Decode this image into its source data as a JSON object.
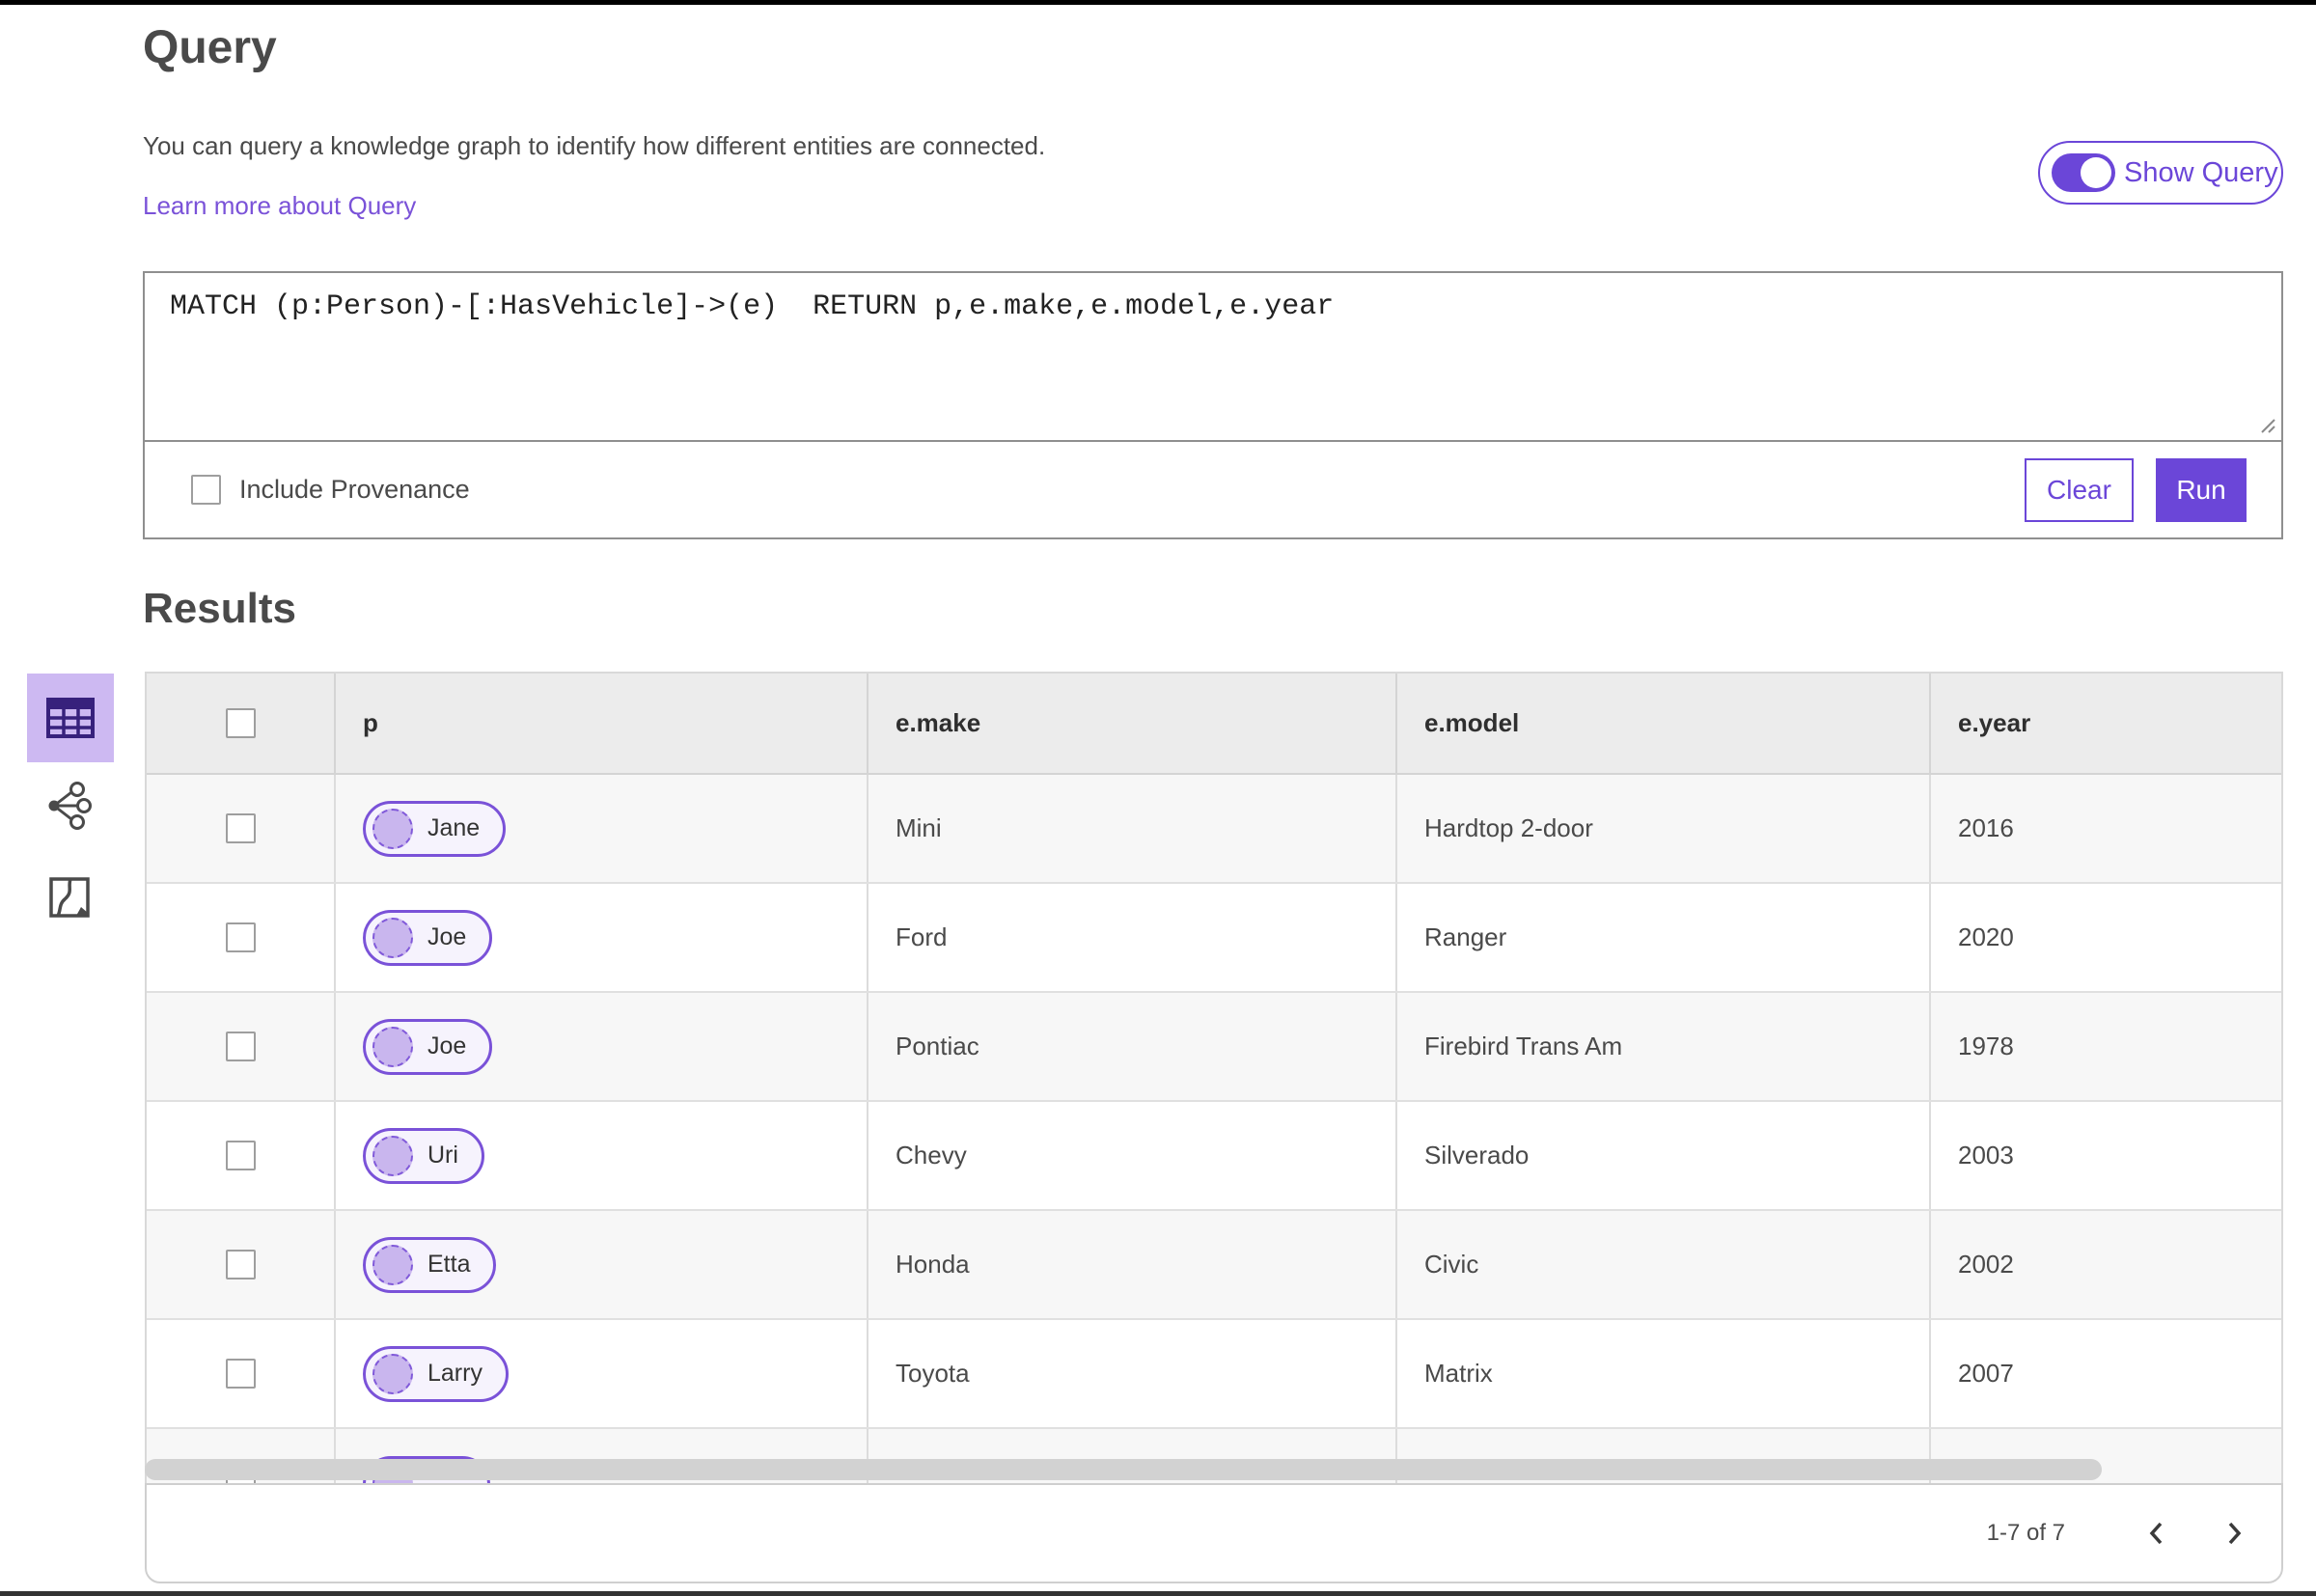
{
  "colors": {
    "accent_purple": "#6b46d8",
    "pill_border_purple": "#7a52d8",
    "selected_view_bg": "#cdb9f2",
    "header_row_bg": "#ececec",
    "alt_row_bg": "#f7f7f7"
  },
  "header": {
    "title": "Query",
    "description": "You can query a knowledge graph to identify how different entities are connected.",
    "learn_more_link": "Learn more about Query",
    "show_query_toggle": {
      "label": "Show Query",
      "state": "on"
    }
  },
  "query_editor": {
    "query_text": "MATCH (p:Person)-[:HasVehicle]->(e)  RETURN p,e.make,e.model,e.year",
    "include_provenance": {
      "label": "Include Provenance",
      "checked": false
    },
    "clear_button": "Clear",
    "run_button": "Run"
  },
  "results": {
    "title": "Results",
    "view_switcher": [
      {
        "name": "table-view",
        "selected": true
      },
      {
        "name": "link-chart-view",
        "selected": false
      },
      {
        "name": "map-view",
        "selected": false
      }
    ],
    "table": {
      "columns": [
        "p",
        "e.make",
        "e.model",
        "e.year"
      ],
      "rows": [
        {
          "p": "Jane",
          "make": "Mini",
          "model": "Hardtop 2-door",
          "year": "2016"
        },
        {
          "p": "Joe",
          "make": "Ford",
          "model": "Ranger",
          "year": "2020"
        },
        {
          "p": "Joe",
          "make": "Pontiac",
          "model": "Firebird Trans Am",
          "year": "1978"
        },
        {
          "p": "Uri",
          "make": "Chevy",
          "model": "Silverado",
          "year": "2003"
        },
        {
          "p": "Etta",
          "make": "Honda",
          "model": "Civic",
          "year": "2002"
        },
        {
          "p": "Larry",
          "make": "Toyota",
          "model": "Matrix",
          "year": "2007"
        },
        {
          "p": "",
          "make": "",
          "model": "",
          "year": "",
          "partial": true
        }
      ]
    },
    "pagination": {
      "range": "1-7 of 7"
    }
  }
}
